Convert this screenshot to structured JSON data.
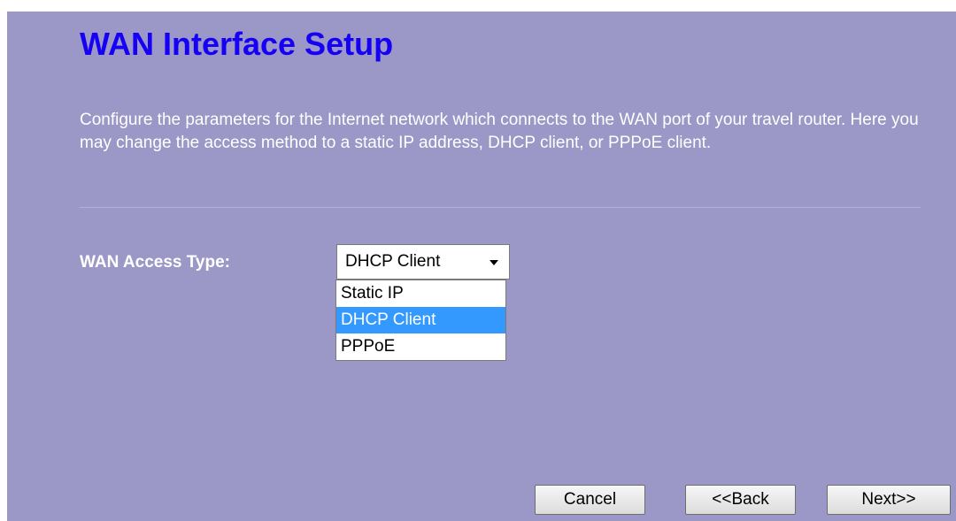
{
  "page": {
    "title": "WAN Interface Setup",
    "description": "Configure the parameters for the Internet network which connects to the WAN port of your travel router. Here you may change the access method to a static IP address, DHCP client, or PPPoE client."
  },
  "wan_access": {
    "label": "WAN Access Type:",
    "selected": "DHCP Client",
    "options": [
      "Static IP",
      "DHCP Client",
      "PPPoE"
    ],
    "highlighted_index": 1
  },
  "buttons": {
    "cancel": "Cancel",
    "back": "<<Back",
    "next": "Next>>"
  },
  "colors": {
    "background": "#9b97c6",
    "title": "#1500f5",
    "highlight": "#3399ff"
  }
}
